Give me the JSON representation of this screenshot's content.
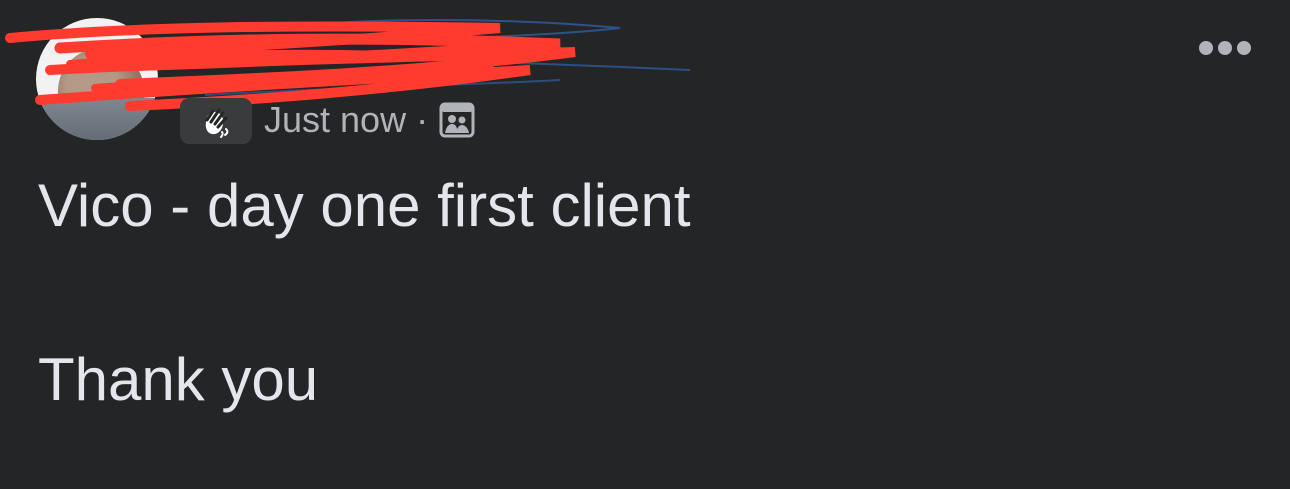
{
  "post": {
    "author_name": "",
    "timestamp": "Just now",
    "separator": "·",
    "audience_icon": "photos-icon",
    "badge_icon": "wave-icon",
    "avatar_icon": "profile-photo",
    "more_icon": "more-horizontal-icon",
    "body_lines": [
      "Vico - day one first client",
      "Thank you"
    ]
  },
  "colors": {
    "background": "#242526",
    "primary_text": "#e4e6eb",
    "secondary_text": "#b0b3b8",
    "badge_background": "#3a3b3c",
    "redaction_red": "#ff3b30",
    "redaction_blue": "#2f5a9a"
  }
}
